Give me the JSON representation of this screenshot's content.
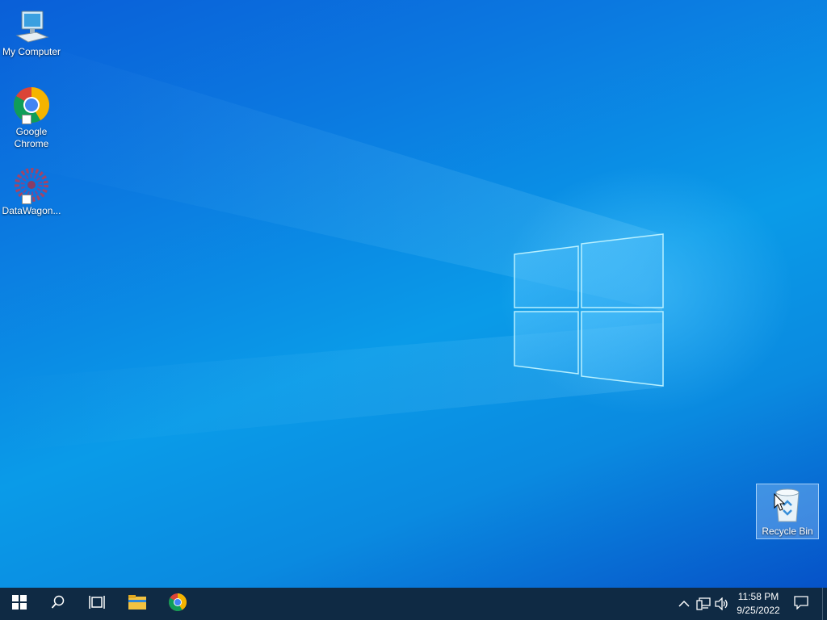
{
  "desktop": {
    "icons": [
      {
        "label": "My Computer",
        "icon": "computer-icon"
      },
      {
        "label": "Google Chrome",
        "icon": "chrome-icon"
      },
      {
        "label": "DataWagon...",
        "icon": "datawagon-icon"
      },
      {
        "label": "Recycle Bin",
        "icon": "recycle-bin-icon",
        "selected": true
      }
    ]
  },
  "taskbar": {
    "buttons": [
      {
        "icon": "windows-start-icon"
      },
      {
        "icon": "search-icon"
      },
      {
        "icon": "task-view-icon"
      },
      {
        "icon": "file-explorer-icon"
      },
      {
        "icon": "chrome-icon"
      }
    ],
    "tray": {
      "icons": [
        "chevron-up-icon",
        "network-icon",
        "volume-icon"
      ],
      "time": "11:58 PM",
      "date": "9/25/2022",
      "notification_icon": "notification-icon"
    }
  },
  "colors": {
    "taskbar_bg": "#0f2a44",
    "wallpaper_accent": "#0a9be8"
  }
}
